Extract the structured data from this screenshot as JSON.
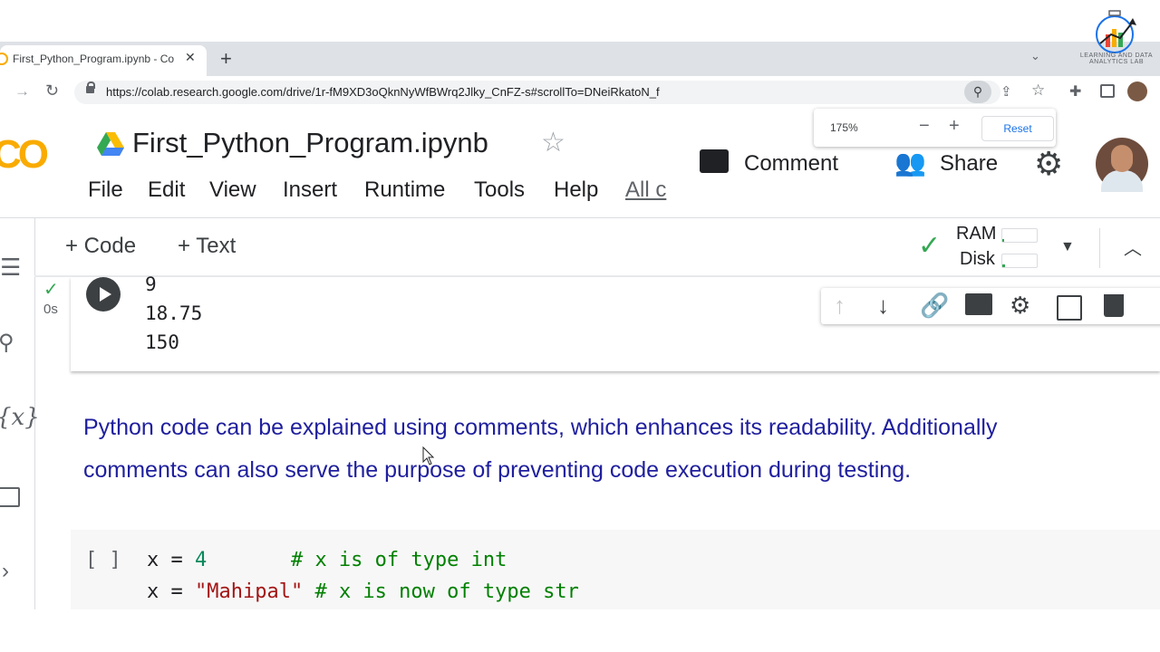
{
  "browser": {
    "tab_title": "First_Python_Program.ipynb - Co",
    "tab_close": "✕",
    "new_tab": "+",
    "tab_menu": "⌄",
    "url": "https://colab.research.google.com/drive/1r-fM9XD3oQknNyWfBWrq2Jlky_CnFZ-s#scrollTo=DNeiRkatoN_f",
    "zoom_popup": {
      "percent": "175%",
      "minus": "−",
      "plus": "+",
      "reset": "Reset"
    }
  },
  "watermark": {
    "text": "LEARNING AND DATA ANALYTICS LAB"
  },
  "colab": {
    "logo": "CO",
    "notebook_title": "First_Python_Program.ipynb",
    "menu": [
      "File",
      "Edit",
      "View",
      "Insert",
      "Runtime",
      "Tools",
      "Help",
      "All c"
    ],
    "comment_label": "Comment",
    "share_label": "Share"
  },
  "toolbar": {
    "add_code": "+ Code",
    "add_text": "+ Text",
    "ram_label": "RAM",
    "disk_label": "Disk",
    "ram_usage": 0.05,
    "disk_usage": 0.08
  },
  "cell1": {
    "exec_time": "0s",
    "outputs": [
      "9",
      "18.75",
      "150"
    ]
  },
  "text_cell": {
    "line1": "Python code can be explained using comments, which enhances its readability. Additionally",
    "line2": "comments can also serve the purpose of preventing code execution during testing."
  },
  "cell2": {
    "bracket": "[ ]",
    "line1": {
      "prefix": "x = ",
      "value": "4",
      "gap": "       ",
      "comment": "# x is of type int"
    },
    "line2": {
      "prefix": "x = ",
      "value": "\"Mahipal\"",
      "gap": " ",
      "comment": "# x is now of type str"
    }
  },
  "colors": {
    "accent_green": "#34a853",
    "text_blue": "#1f1f9e",
    "colab_orange": "#f9ab00"
  }
}
